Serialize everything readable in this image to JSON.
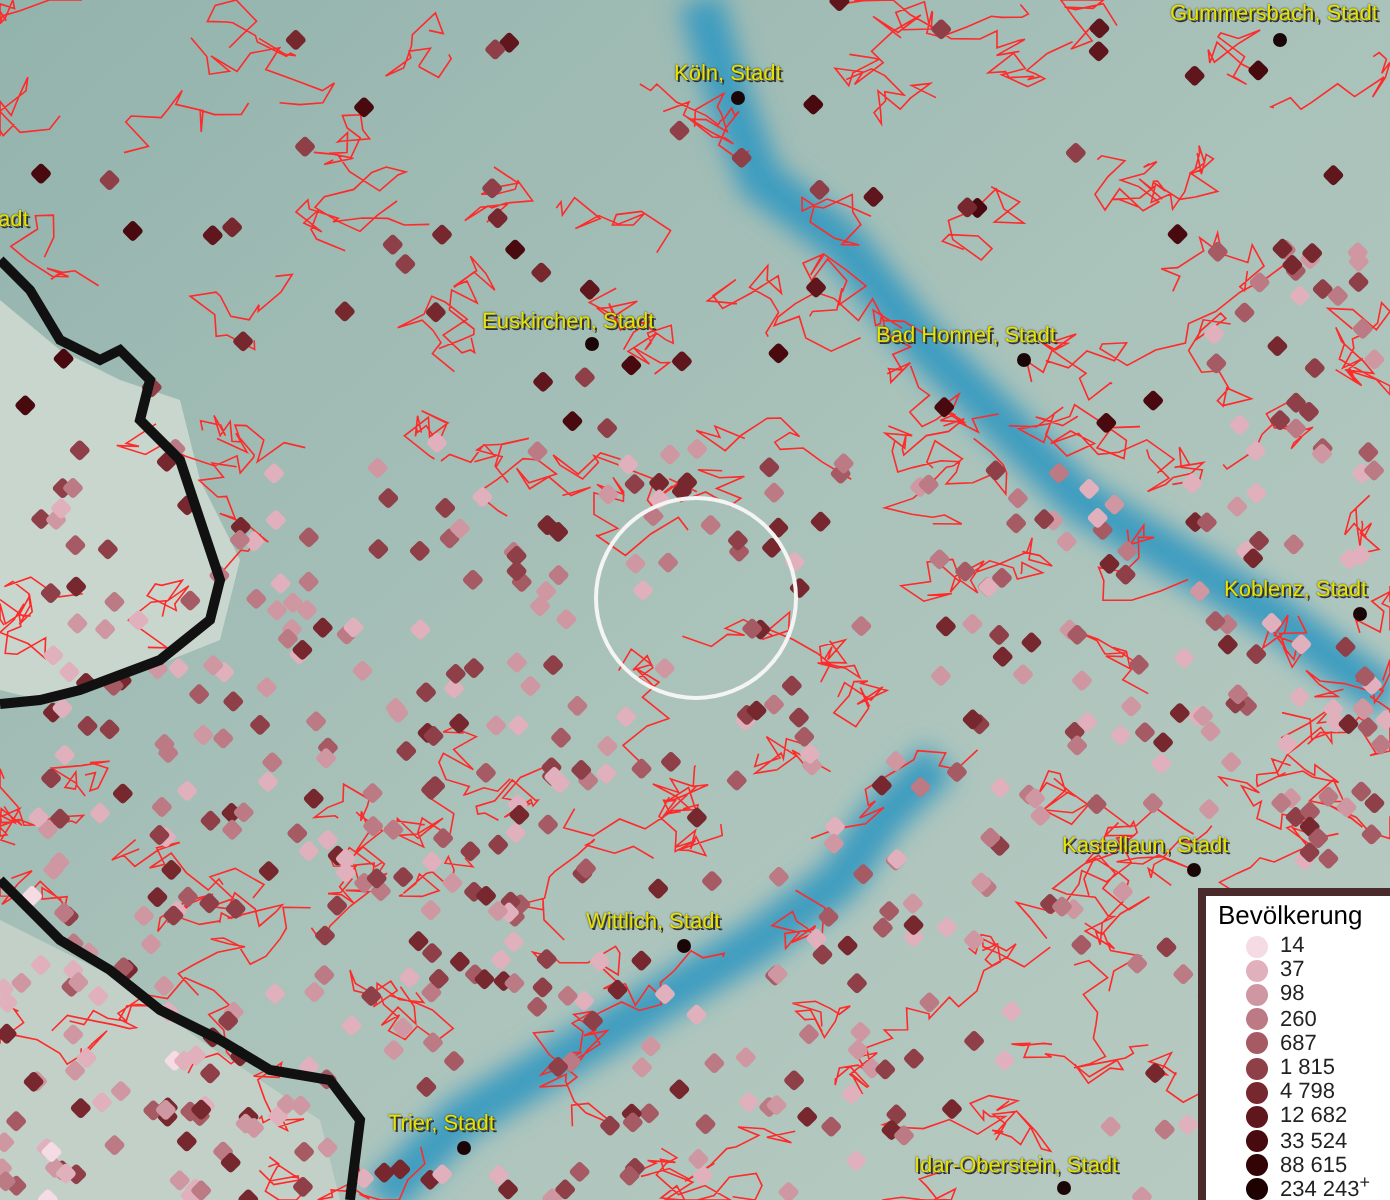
{
  "map": {
    "places": [
      {
        "name": "Köln, Stadt"
      },
      {
        "name": "Gummersbach, Stadt"
      },
      {
        "name": "adt"
      },
      {
        "name": "Euskirchen, Stadt"
      },
      {
        "name": "Bad Honnef, Stadt"
      },
      {
        "name": "Koblenz, Stadt"
      },
      {
        "name": "Kastellaun, Stadt"
      },
      {
        "name": "Wittlich, Stadt"
      },
      {
        "name": "Trier, Stadt"
      },
      {
        "name": "Idar-Oberstein, Stadt"
      }
    ]
  },
  "legend": {
    "title": "Bevölkerung",
    "items": [
      {
        "label": "14",
        "color": "#f4dbe4"
      },
      {
        "label": "37",
        "color": "#e0b0bc"
      },
      {
        "label": "98",
        "color": "#cf97a1"
      },
      {
        "label": "260",
        "color": "#bb7a84"
      },
      {
        "label": "687",
        "color": "#a65a63"
      },
      {
        "label": "1 815",
        "color": "#8e3f47"
      },
      {
        "label": "4 798",
        "color": "#77282f"
      },
      {
        "label": "12 682",
        "color": "#5f161c"
      },
      {
        "label": "33 524",
        "color": "#480a0e"
      },
      {
        "label": "88 615",
        "color": "#330405"
      },
      {
        "label": "234 243$^{+}$",
        "color": "#1e0202"
      }
    ]
  }
}
